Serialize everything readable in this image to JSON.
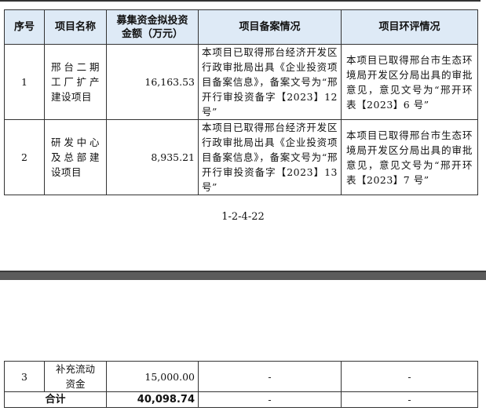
{
  "table": {
    "headers": [
      "序号",
      "项目名称",
      "募集资金拟投资金额（万元）",
      "项目备案情况",
      "项目环评情况"
    ],
    "rows": [
      {
        "no": "1",
        "name": "邢台二期工厂扩产建设项目",
        "amount": "16,163.53",
        "filing": "本项目已取得邢台经济开发区行政审批局出具《企业投资项目备案信息》，备案文号为“邢开行审投资备字【2023】12 号”",
        "eia": "本项目已取得邢台市生态环境局开发区分局出具的审批意见，意见文号为“邢开环表【2023】6 号”"
      },
      {
        "no": "2",
        "name": "研发中心及总部建设项目",
        "amount": "8,935.21",
        "filing": "本项目已取得邢台经济开发区行政审批局出具《企业投资项目备案信息》，备案文号为“邢开行审投资备字【2023】13 号”",
        "eia": "本项目已取得邢台市生态环境局开发区分局出具的审批意见，意见文号为“邢开环表【2023】7 号”"
      },
      {
        "no": "3",
        "name": "补充流动资金",
        "amount": "15,000.00",
        "filing": "-",
        "eia": "-"
      }
    ],
    "total": {
      "label": "合计",
      "amount": "40,098.74",
      "filing": "-",
      "eia": "-"
    }
  },
  "page_number": "1-2-4-22"
}
